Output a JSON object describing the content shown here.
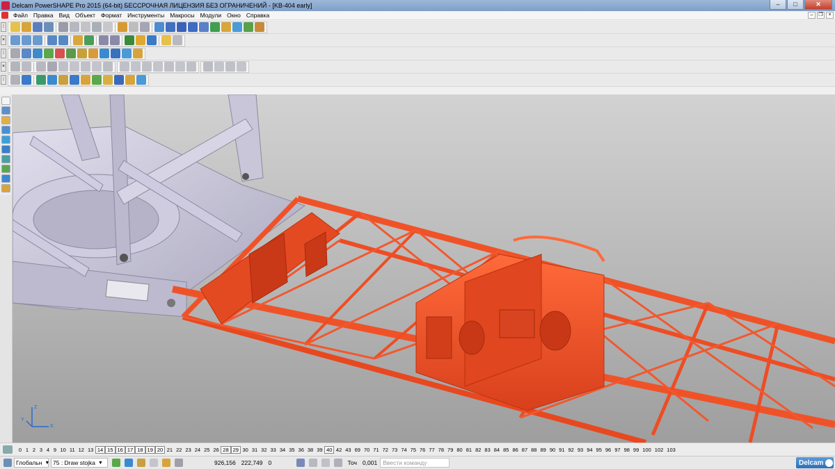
{
  "window": {
    "title": "Delcam PowerSHAPE Pro 2015 (64-bit) БЕССРОЧНАЯ ЛИЦЕНЗИЯ БЕЗ ОГРАНИЧЕНИЙ - [KB-404 early]",
    "minimize": "–",
    "maximize": "□",
    "close": "✕"
  },
  "menu": {
    "items": [
      "Файл",
      "Правка",
      "Вид",
      "Объект",
      "Формат",
      "Инструменты",
      "Макросы",
      "Модули",
      "Окно",
      "Справка"
    ],
    "doc_minimize": "–",
    "doc_restore": "❐",
    "doc_close": "×"
  },
  "viewport": {
    "axis_z": "Z",
    "axis_y": "Y",
    "axis_x": "X",
    "colors": {
      "frame": "#ee4a22",
      "structure": "#c9c6da",
      "background": "#b8b8b8"
    }
  },
  "levels": {
    "numbers": [
      "0",
      "1",
      "2",
      "3",
      "4",
      "9",
      "10",
      "11",
      "12",
      "13",
      "14",
      "15",
      "16",
      "17",
      "18",
      "19",
      "20",
      "21",
      "22",
      "23",
      "24",
      "25",
      "26",
      "28",
      "29",
      "30",
      "31",
      "32",
      "33",
      "34",
      "35",
      "36",
      "38",
      "39",
      "40",
      "42",
      "43",
      "69",
      "70",
      "71",
      "72",
      "73",
      "74",
      "75",
      "76",
      "77",
      "78",
      "79",
      "80",
      "81",
      "82",
      "83",
      "84",
      "85",
      "86",
      "87",
      "88",
      "89",
      "90",
      "91",
      "92",
      "93",
      "94",
      "95",
      "96",
      "97",
      "98",
      "99",
      "100",
      "102",
      "103"
    ],
    "boxed": [
      "14",
      "15",
      "16",
      "17",
      "18",
      "19",
      "20",
      "28",
      "29",
      "40"
    ]
  },
  "status": {
    "workplane": "Глобальн",
    "level": "75 : Draw stojka",
    "coord_x": "926,156",
    "coord_y": "222,749",
    "coord_z": "0",
    "tolerance_label": "Точ",
    "tolerance": "0,001",
    "command_placeholder": "Ввести команду",
    "brand": "Delcam"
  }
}
